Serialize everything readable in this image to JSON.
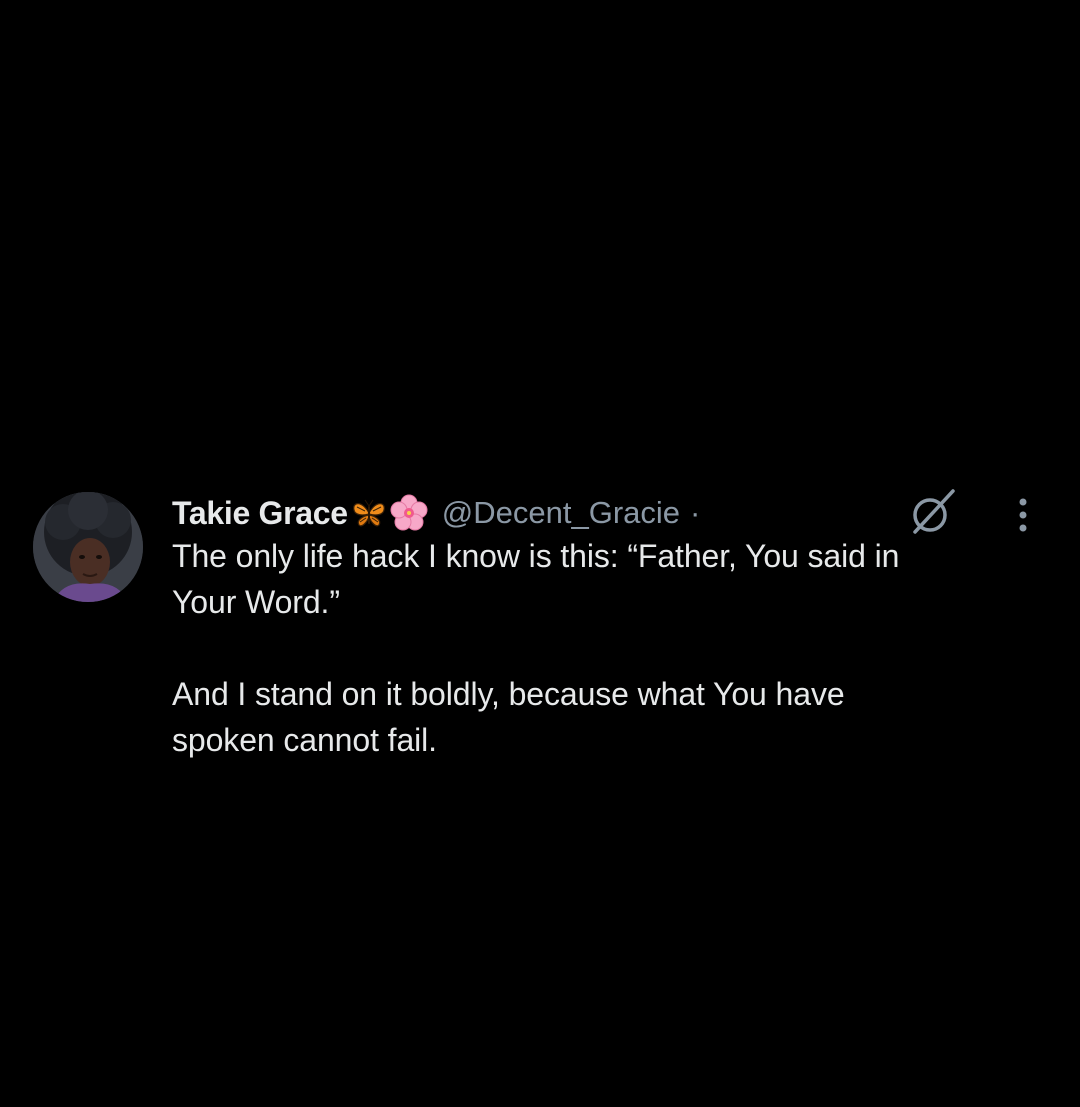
{
  "tweet": {
    "author": {
      "display_name": "Takie Grace",
      "emojis": [
        "butterfly-emoji",
        "cherry-blossom-emoji"
      ],
      "handle": "@Decent_Gracie",
      "separator": "·"
    },
    "text_paragraphs": [
      "The only life hack I know is this: “Father, You said in\nYour Word.”",
      "And I stand on it boldly, because what You have\nspoken cannot fail."
    ],
    "icons": {
      "grok": "grok-icon",
      "more": "more-vertical-icon"
    }
  },
  "colors": {
    "background": "#000000",
    "text_primary": "#e7e9ea",
    "text_secondary": "#8b98a5"
  }
}
